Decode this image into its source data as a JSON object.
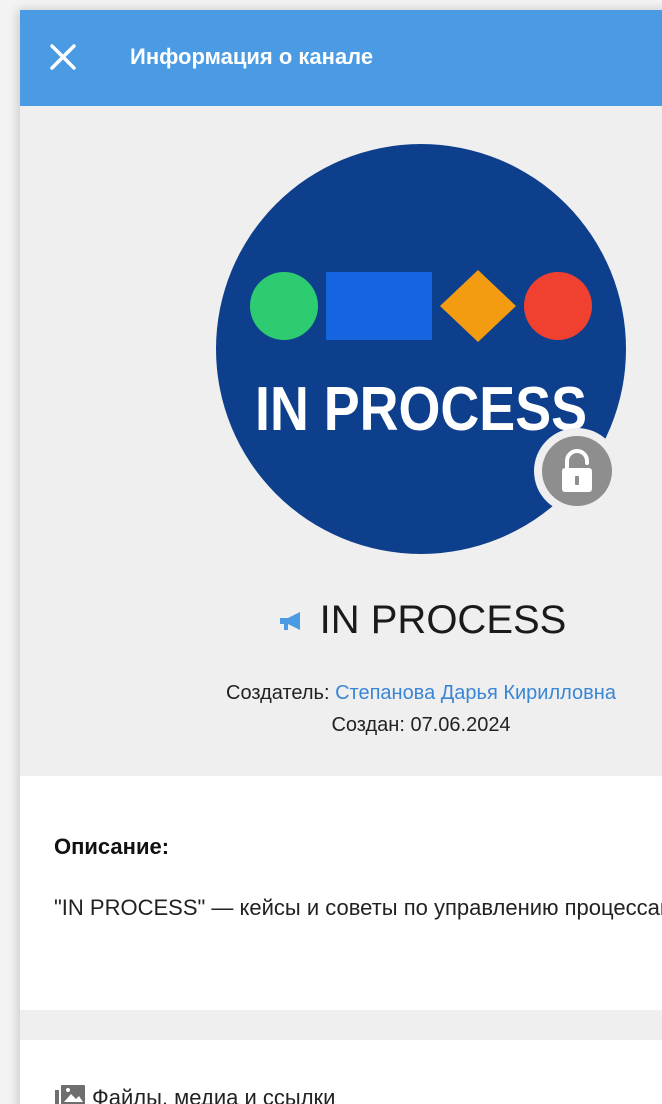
{
  "header": {
    "title": "Информация о канале",
    "close_icon": "close-icon"
  },
  "avatar": {
    "logo_text": "IN PROCESS",
    "badge_icon": "unlock-icon",
    "colors": {
      "background": "#0d3f8c",
      "circle_green": "#2ecc71",
      "rect_blue": "#1565e0",
      "diamond_orange": "#f39c12",
      "circle_red": "#f0402f"
    }
  },
  "channel": {
    "type_icon": "megaphone-icon",
    "name": "IN PROCESS",
    "creator_label": "Создатель: ",
    "creator_name": "Степанова Дарья Кирилловна",
    "created": "Создан: 07.06.2024"
  },
  "description": {
    "title": "Описание:",
    "text": "\"IN PROCESS\" — кейсы и советы по управлению процессами"
  },
  "files": {
    "icon": "media-icon",
    "label": "Файлы, медиа и ссылки"
  },
  "colors": {
    "header": "#4a9be4",
    "link": "#3a86d6"
  }
}
